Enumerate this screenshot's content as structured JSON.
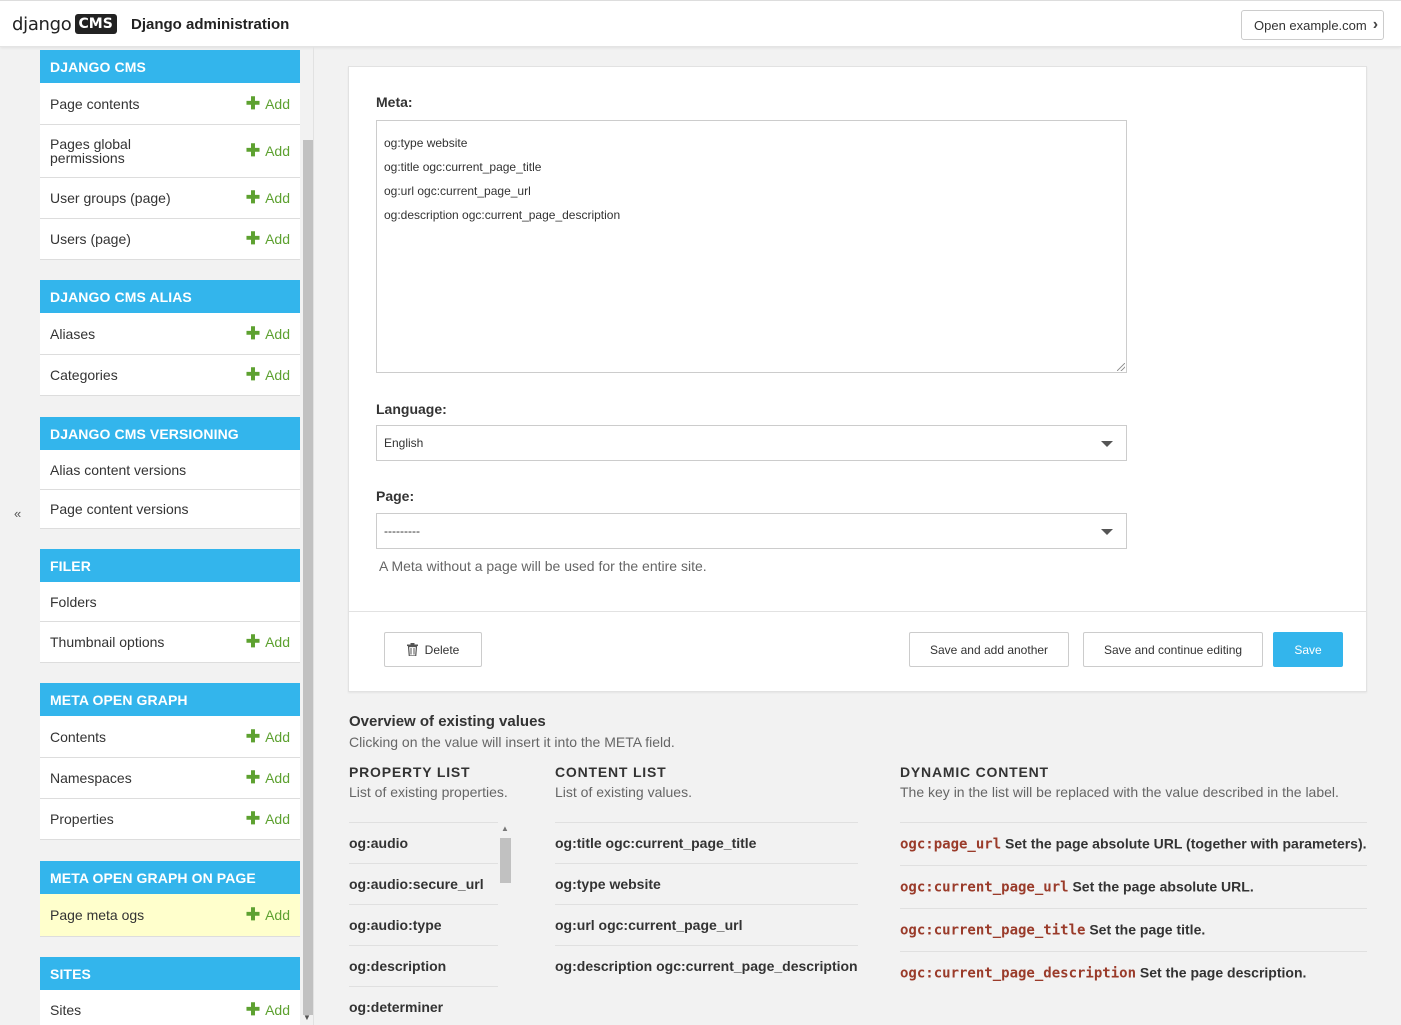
{
  "header": {
    "logo_word": "django",
    "logo_badge": "CMS",
    "title": "Django administration",
    "open_site": "Open example.com"
  },
  "sidebar": {
    "collapse": "«",
    "modules": [
      {
        "name": "DJANGO CMS",
        "items": [
          {
            "label": "Page contents",
            "add": "Add"
          },
          {
            "label": "Pages global permissions",
            "add": "Add"
          },
          {
            "label": "User groups (page)",
            "add": "Add"
          },
          {
            "label": "Users (page)",
            "add": "Add"
          }
        ]
      },
      {
        "name": "DJANGO CMS ALIAS",
        "items": [
          {
            "label": "Aliases",
            "add": "Add"
          },
          {
            "label": "Categories",
            "add": "Add"
          }
        ]
      },
      {
        "name": "DJANGO CMS VERSIONING",
        "items": [
          {
            "label": "Alias content versions"
          },
          {
            "label": "Page content versions"
          }
        ]
      },
      {
        "name": "FILER",
        "items": [
          {
            "label": "Folders"
          },
          {
            "label": "Thumbnail options",
            "add": "Add"
          }
        ]
      },
      {
        "name": "META OPEN GRAPH",
        "items": [
          {
            "label": "Contents",
            "add": "Add"
          },
          {
            "label": "Namespaces",
            "add": "Add"
          },
          {
            "label": "Properties",
            "add": "Add"
          }
        ]
      },
      {
        "name": "META OPEN GRAPH ON PAGE",
        "items": [
          {
            "label": "Page meta ogs",
            "add": "Add"
          }
        ]
      },
      {
        "name": "SITES",
        "items": [
          {
            "label": "Sites",
            "add": "Add"
          }
        ]
      }
    ]
  },
  "form": {
    "meta_label": "Meta:",
    "meta_lines": [
      "og:type website",
      "og:title ogc:current_page_title",
      "og:url ogc:current_page_url",
      "og:description ogc:current_page_description"
    ],
    "language_label": "Language:",
    "language_value": "English",
    "page_label": "Page:",
    "page_value": "---------",
    "page_help": "A Meta without a page will be used for the entire site.",
    "delete": "Delete",
    "save_add_another": "Save and add another",
    "save_continue": "Save and continue editing",
    "save": "Save"
  },
  "overview": {
    "title": "Overview of existing values",
    "subtitle": "Clicking on the value will insert it into the META field.",
    "property_list": {
      "heading": "PROPERTY LIST",
      "sub": "List of existing properties.",
      "items": [
        "og:audio",
        "og:audio:secure_url",
        "og:audio:type",
        "og:description",
        "og:determiner"
      ]
    },
    "content_list": {
      "heading": "CONTENT LIST",
      "sub": "List of existing values.",
      "items": [
        "og:title ogc:current_page_title",
        "og:type website",
        "og:url ogc:current_page_url",
        "og:description ogc:current_page_description"
      ]
    },
    "dynamic_content": {
      "heading": "DYNAMIC CONTENT",
      "sub": "The key in the list will be replaced with the value described in the label.",
      "items": [
        {
          "key": "ogc:page_url",
          "desc": "Set the page absolute URL (together with parameters)."
        },
        {
          "key": "ogc:current_page_url",
          "desc": "Set the page absolute URL."
        },
        {
          "key": "ogc:current_page_title",
          "desc": "Set the page title."
        },
        {
          "key": "ogc:current_page_description",
          "desc": "Set the page description."
        }
      ]
    }
  },
  "colors": {
    "accent": "#33b5ec",
    "add_green": "#5da130",
    "highlight_row": "#ffffcc",
    "dynamic_key": "#9a3b2a"
  }
}
